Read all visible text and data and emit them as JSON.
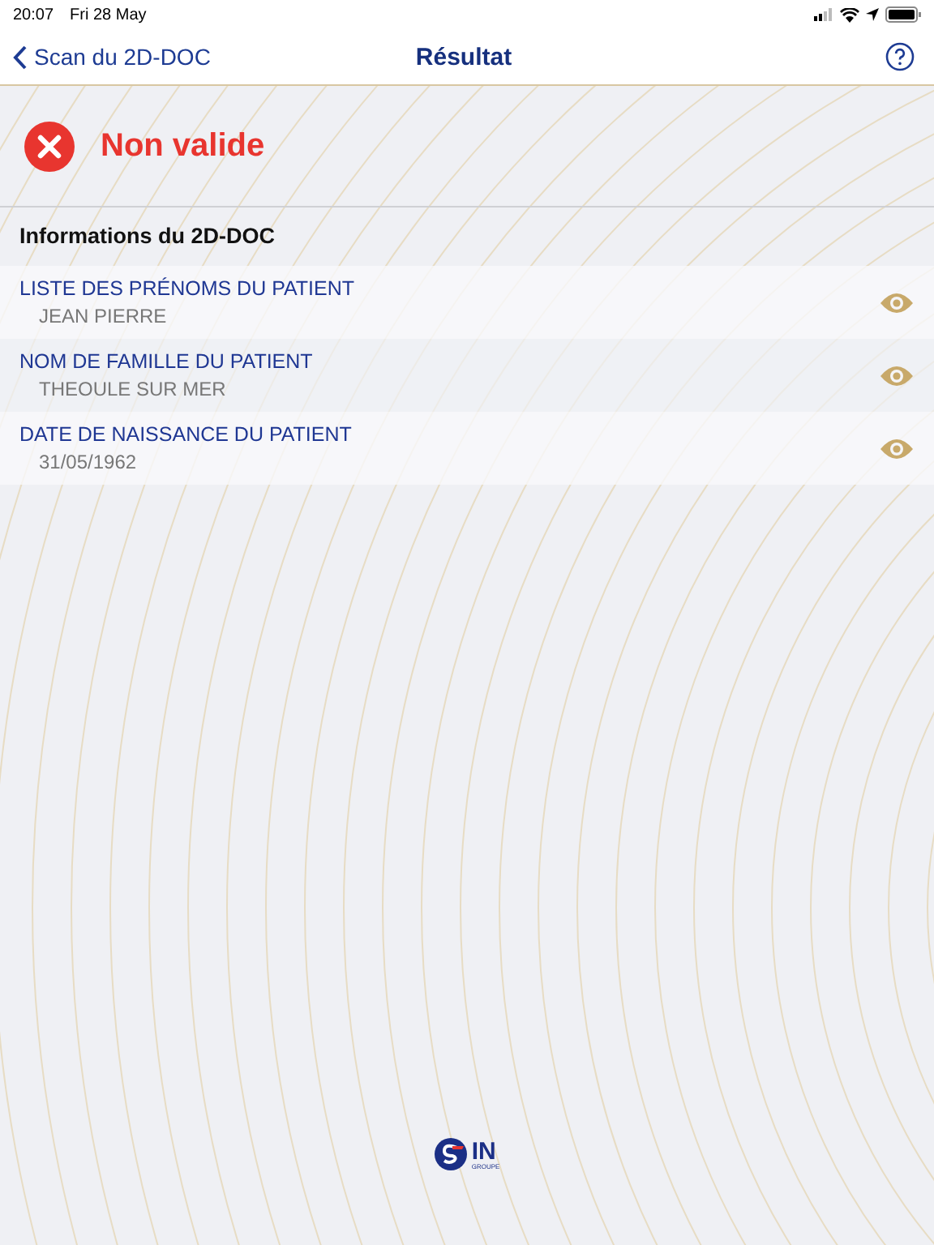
{
  "status_bar": {
    "time": "20:07",
    "date": "Fri 28 May"
  },
  "nav_bar": {
    "back_label": "Scan du 2D-DOC",
    "title": "Résultat"
  },
  "result": {
    "kind": "invalid",
    "label": "Non valide"
  },
  "section": {
    "title": "Informations du 2D-DOC"
  },
  "fields": [
    {
      "label": "LISTE DES PRÉNOMS DU PATIENT",
      "value": "JEAN PIERRE"
    },
    {
      "label": "NOM DE FAMILLE DU PATIENT",
      "value": "THEOULE SUR MER"
    },
    {
      "label": "DATE DE NAISSANCE DU PATIENT",
      "value": "31/05/1962"
    }
  ],
  "logo": {
    "mark": "IN",
    "sub": "GROUPE"
  }
}
